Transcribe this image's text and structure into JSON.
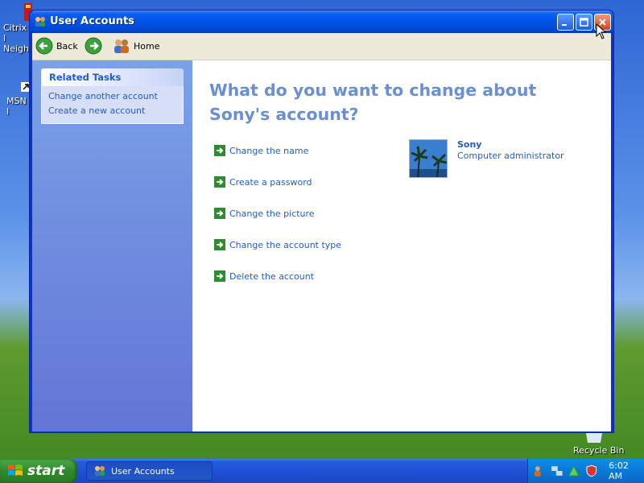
{
  "desktop": {
    "icons": [
      {
        "label_line1": "Citrix I",
        "label_line2": "Neight"
      },
      {
        "label_line1": "MSN I"
      },
      {
        "label_line1": "Recycle Bin"
      }
    ]
  },
  "window": {
    "title": "User Accounts",
    "icon": "user-accounts-icon"
  },
  "toolbar": {
    "back_label": "Back",
    "forward_icon": "forward-arrow-icon",
    "home_label": "Home"
  },
  "sidebar": {
    "related_tasks": {
      "heading": "Related Tasks",
      "items": [
        {
          "label": "Change another account"
        },
        {
          "label": "Create a new account"
        }
      ]
    }
  },
  "main": {
    "heading": "What do you want to change about Sony's account?",
    "actions": [
      {
        "label": "Change the name"
      },
      {
        "label": "Create a password"
      },
      {
        "label": "Change the picture"
      },
      {
        "label": "Change the account type"
      },
      {
        "label": "Delete the account"
      }
    ],
    "account": {
      "name": "Sony",
      "type": "Computer administrator"
    }
  },
  "taskbar": {
    "start_label": "start",
    "open_window": "User Accounts",
    "clock": "6:02 AM"
  },
  "colors": {
    "link": "#215dc6",
    "heading": "#6b8fd3",
    "titlebar": "#0053e6",
    "sidebar": "#7ba2e7"
  }
}
